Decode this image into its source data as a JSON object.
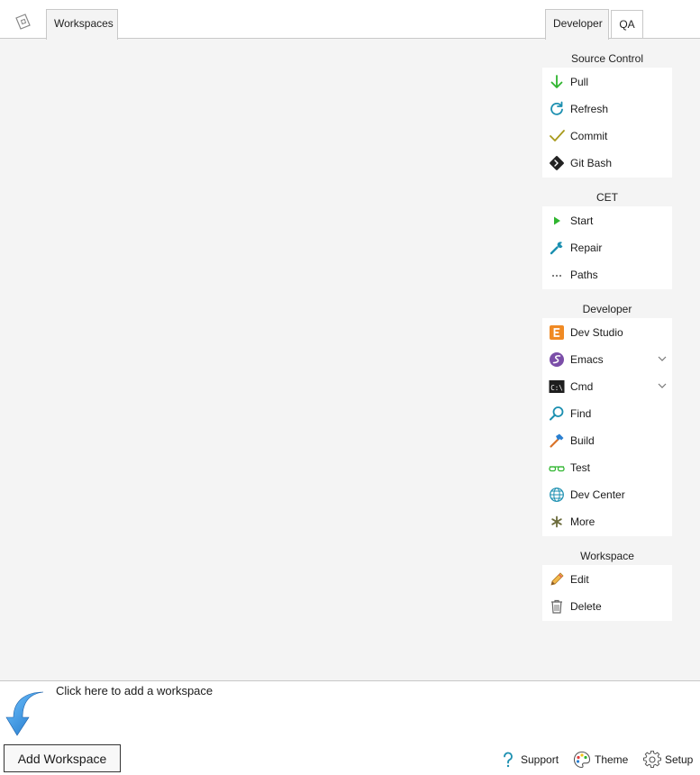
{
  "tabs_left": [
    {
      "label": "Workspaces",
      "active": true
    }
  ],
  "tabs_right": [
    {
      "label": "Developer",
      "active": true
    },
    {
      "label": "QA",
      "active": false
    }
  ],
  "groups": {
    "source_control": {
      "title": "Source Control",
      "items": [
        {
          "label": "Pull",
          "icon": "down-arrow-icon"
        },
        {
          "label": "Refresh",
          "icon": "refresh-icon"
        },
        {
          "label": "Commit",
          "icon": "checkmark-icon"
        },
        {
          "label": "Git Bash",
          "icon": "git-icon"
        }
      ]
    },
    "cet": {
      "title": "CET",
      "items": [
        {
          "label": "Start",
          "icon": "play-icon"
        },
        {
          "label": "Repair",
          "icon": "wrench-icon"
        },
        {
          "label": "Paths",
          "icon": "ellipsis-icon"
        }
      ]
    },
    "developer": {
      "title": "Developer",
      "items": [
        {
          "label": "Dev Studio",
          "icon": "dev-studio-icon"
        },
        {
          "label": "Emacs",
          "icon": "emacs-icon"
        },
        {
          "label": "Cmd",
          "icon": "terminal-icon",
          "icon_text": "C:\\"
        },
        {
          "label": "Find",
          "icon": "magnifier-icon"
        },
        {
          "label": "Build",
          "icon": "hammer-icon"
        },
        {
          "label": "Test",
          "icon": "glasses-icon"
        },
        {
          "label": "Dev Center",
          "icon": "globe-icon"
        },
        {
          "label": "More",
          "icon": "asterisk-icon"
        }
      ]
    },
    "workspace": {
      "title": "Workspace",
      "items": [
        {
          "label": "Edit",
          "icon": "pencil-icon"
        },
        {
          "label": "Delete",
          "icon": "trash-icon"
        }
      ]
    }
  },
  "bottom": {
    "hint": "Click here to add a workspace",
    "add_button": "Add Workspace",
    "support": "Support",
    "theme": "Theme",
    "setup": "Setup"
  },
  "colors": {
    "panel_bg": "#f4f4f4",
    "green": "#2fb52f",
    "teal": "#1b8fb0",
    "olive": "#a89a1c",
    "arrow_blue": "#2a8ee0"
  }
}
